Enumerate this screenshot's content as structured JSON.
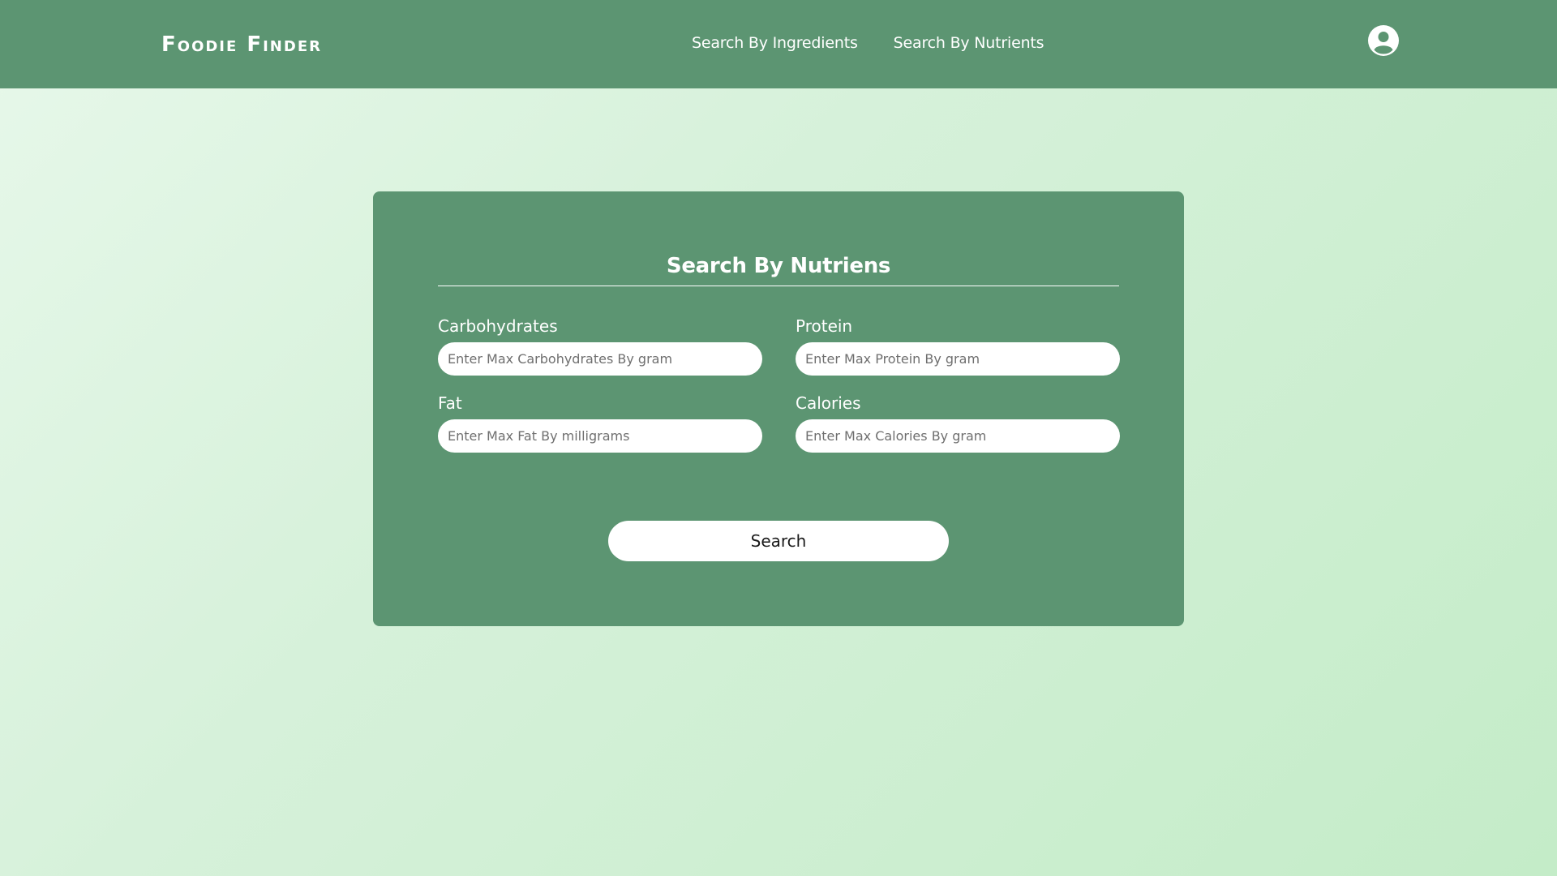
{
  "header": {
    "brand": "Foodie Finder",
    "nav": [
      {
        "label": "Search By Ingredients"
      },
      {
        "label": "Search By Nutrients"
      }
    ],
    "user_icon": "user-circle-icon"
  },
  "form": {
    "title": "Search By Nutriens",
    "fields": {
      "carbohydrates": {
        "label": "Carbohydrates",
        "placeholder": "Enter Max Carbohydrates By gram"
      },
      "protein": {
        "label": "Protein",
        "placeholder": "Enter Max Protein By gram"
      },
      "fat": {
        "label": "Fat",
        "placeholder": "Enter Max Fat By milligrams"
      },
      "calories": {
        "label": "Calories",
        "placeholder": "Enter Max Calories By gram"
      }
    },
    "submit_label": "Search"
  },
  "colors": {
    "primary_green": "#5c9572",
    "background_light": "#e7f8ea",
    "background_end": "#c4ecc8",
    "input_bg": "#ffffff",
    "text_on_green": "#ffffff"
  }
}
